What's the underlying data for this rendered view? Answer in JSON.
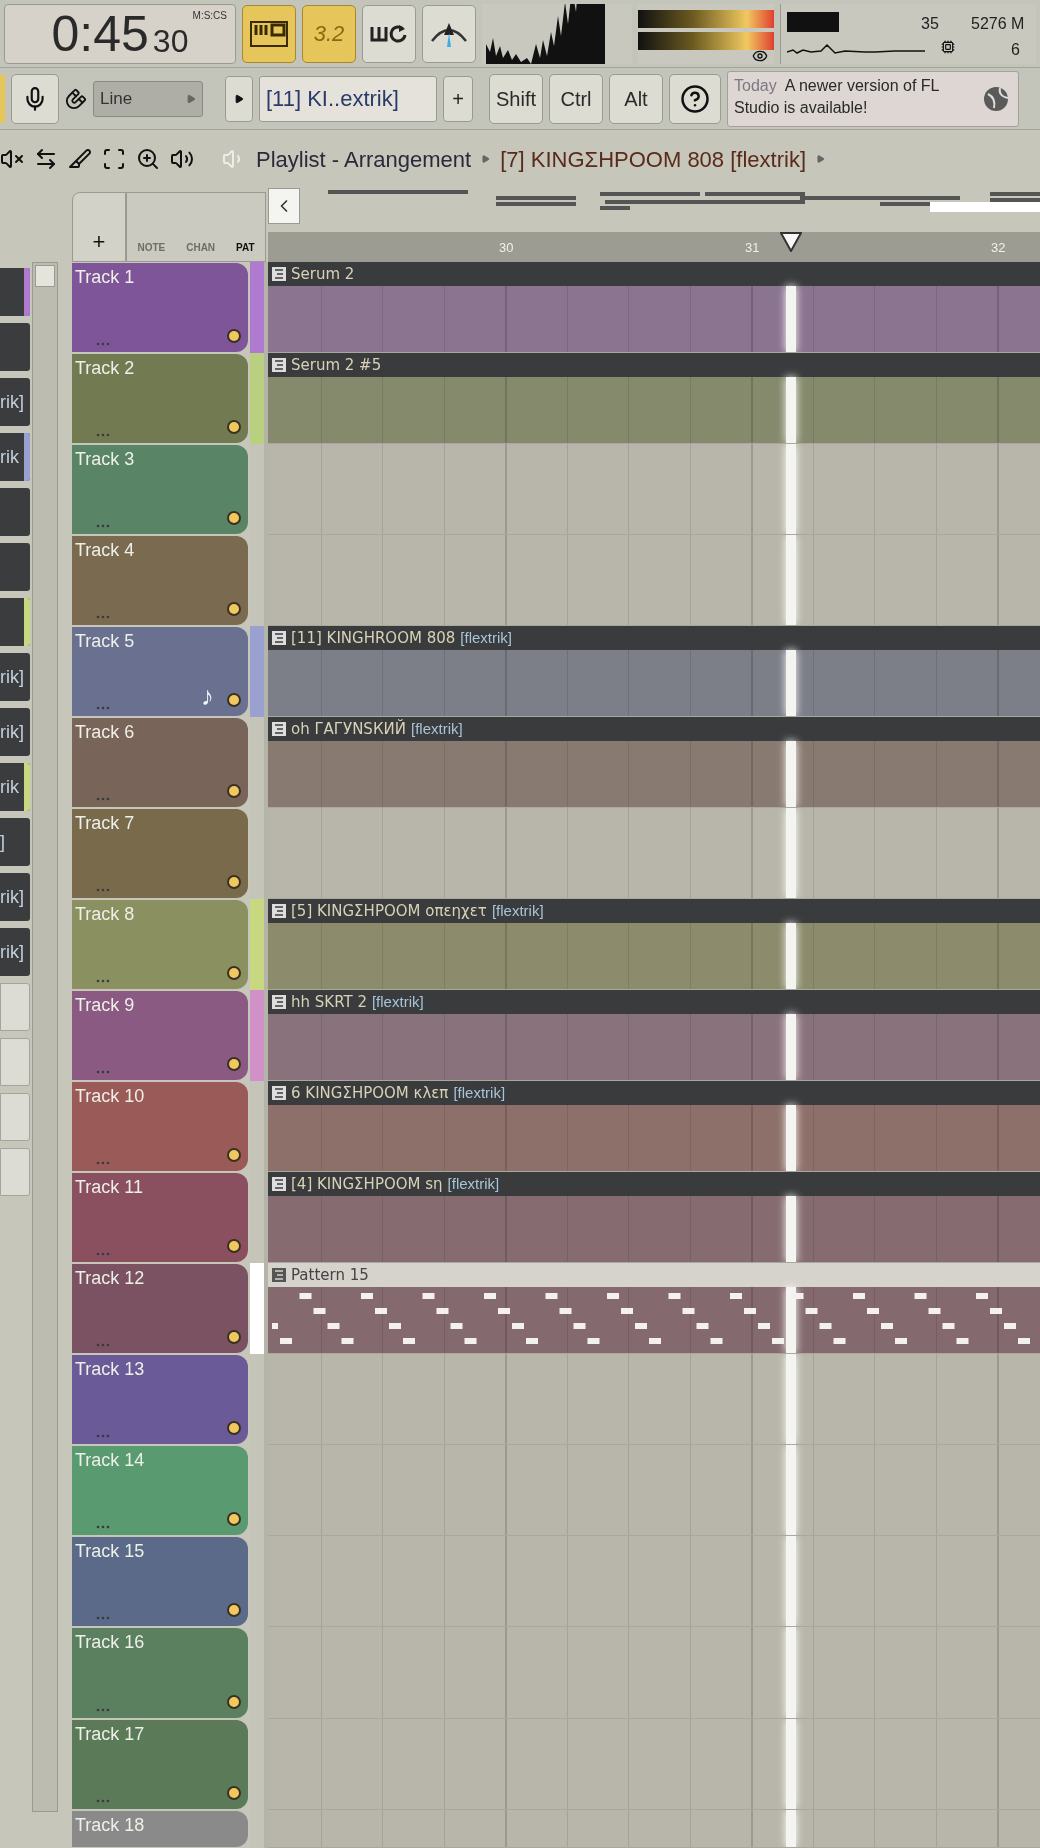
{
  "clock": {
    "time": "0:45",
    "centiseconds": "30",
    "format": "M:S:CS"
  },
  "top_buttons": [
    {
      "kind": "pattern",
      "on": true
    },
    {
      "kind": "tempo",
      "label": "3.2",
      "on": true
    },
    {
      "kind": "loop",
      "on": false
    },
    {
      "kind": "metronome",
      "on": false
    }
  ],
  "monitor": {
    "cpu": "35",
    "memory": "5276 M",
    "polyphony": "6"
  },
  "input": {
    "label": "Line"
  },
  "pattern_selector": {
    "value": "[11] KI..extrik]",
    "add": "+"
  },
  "modifier_keys": [
    "Shift",
    "Ctrl",
    "Alt"
  ],
  "news": {
    "date": "Today",
    "message": "A newer version of FL Studio is available!"
  },
  "playlist": {
    "title": "Playlist - Arrangement",
    "pattern": "[7] KINGΣΗΡΟΟΜ 808 [flextrik]"
  },
  "add_track": "+",
  "view_tabs": [
    {
      "label": "NOTE",
      "selected": false
    },
    {
      "label": "CHAN",
      "selected": false
    },
    {
      "label": "PAT",
      "selected": true
    }
  ],
  "ruler": [
    "30",
    "31",
    "32"
  ],
  "channels": [
    {
      "kind": "dark",
      "color": "#b07ad0"
    },
    {
      "kind": "dark"
    },
    {
      "kind": "dark",
      "label": "rik]"
    },
    {
      "kind": "dark",
      "label": "rik",
      "color": "#9aa0d0"
    },
    {
      "kind": "dark"
    },
    {
      "kind": "dark"
    },
    {
      "kind": "dark",
      "color": "#c8d880"
    },
    {
      "kind": "dark",
      "label": "rik]"
    },
    {
      "kind": "dark",
      "label": "rik]"
    },
    {
      "kind": "dark",
      "label": "rik",
      "color": "#c8d880"
    },
    {
      "kind": "dark",
      "label": "]"
    },
    {
      "kind": "dark",
      "label": "rik]"
    },
    {
      "kind": "dark",
      "label": "rik]"
    },
    {
      "kind": "light"
    },
    {
      "kind": "light"
    },
    {
      "kind": "light"
    },
    {
      "kind": "light"
    }
  ],
  "tracks": [
    {
      "name": "Track 1",
      "color": "#7f5599",
      "marker": {
        "color": "#b07ad0"
      },
      "clip": {
        "kind": "audio",
        "name": "Serum 2",
        "color": "#8a7490"
      }
    },
    {
      "name": "Track 2",
      "color": "#727a52",
      "marker": {
        "color": "#b8d080"
      },
      "clip": {
        "kind": "audio",
        "name": "Serum 2 #5",
        "color": "#868a6c"
      }
    },
    {
      "name": "Track 3",
      "color": "#5a8466"
    },
    {
      "name": "Track 4",
      "color": "#7a6a50"
    },
    {
      "name": "Track 5",
      "color": "#6a7090",
      "marker": {
        "color": "#9aa0d0"
      },
      "symbol": "♪",
      "clip": {
        "kind": "audio",
        "name": "[11] KINGHROOM 808",
        "tag": "[flextrik]",
        "color": "#7c7e88"
      }
    },
    {
      "name": "Track 6",
      "color": "#786458",
      "clip": {
        "kind": "audio",
        "name": "oh ГАГУNSКИЙ",
        "tag": "[flextrik]",
        "color": "#887a70"
      }
    },
    {
      "name": "Track 7",
      "color": "#7a6a4c"
    },
    {
      "name": "Track 8",
      "color": "#8a9060",
      "marker": {
        "color": "#c8d880"
      },
      "clip": {
        "kind": "audio",
        "name": "[5] KINGΣΗΡΟΟΜ οπεηχετ",
        "tag": "[flextrik]",
        "color": "#8c8c6c"
      }
    },
    {
      "name": "Track 9",
      "color": "#8a5a82",
      "marker": {
        "color": "#d090c8"
      },
      "clip": {
        "kind": "audio",
        "name": "hh SKRT 2",
        "tag": "[flextrik]",
        "color": "#8a727c"
      }
    },
    {
      "name": "Track 10",
      "color": "#9a5a58",
      "clip": {
        "kind": "audio",
        "name": "6 KINGΣΗΡΟΟΜ κλεπ",
        "tag": "[flextrik]",
        "color": "#8e706a"
      }
    },
    {
      "name": "Track 11",
      "color": "#8a5060",
      "clip": {
        "kind": "audio",
        "name": "[4] KINGΣΗΡΟΟΜ sη",
        "tag": "[flextrik]",
        "color": "#866c70"
      }
    },
    {
      "name": "Track 12",
      "color": "#7a5262",
      "marker": {
        "color": "#ffffff"
      },
      "clip": {
        "kind": "pattern",
        "name": "Pattern 15",
        "color": "#846a6e"
      }
    },
    {
      "name": "Track 13",
      "color": "#6a5a98"
    },
    {
      "name": "Track 14",
      "color": "#5a9a70"
    },
    {
      "name": "Track 15",
      "color": "#5a6a88"
    },
    {
      "name": "Track 16",
      "color": "#5a8060"
    },
    {
      "name": "Track 17",
      "color": "#5a7a58"
    },
    {
      "name": "Track 18",
      "color": "#8a8a8a"
    }
  ]
}
